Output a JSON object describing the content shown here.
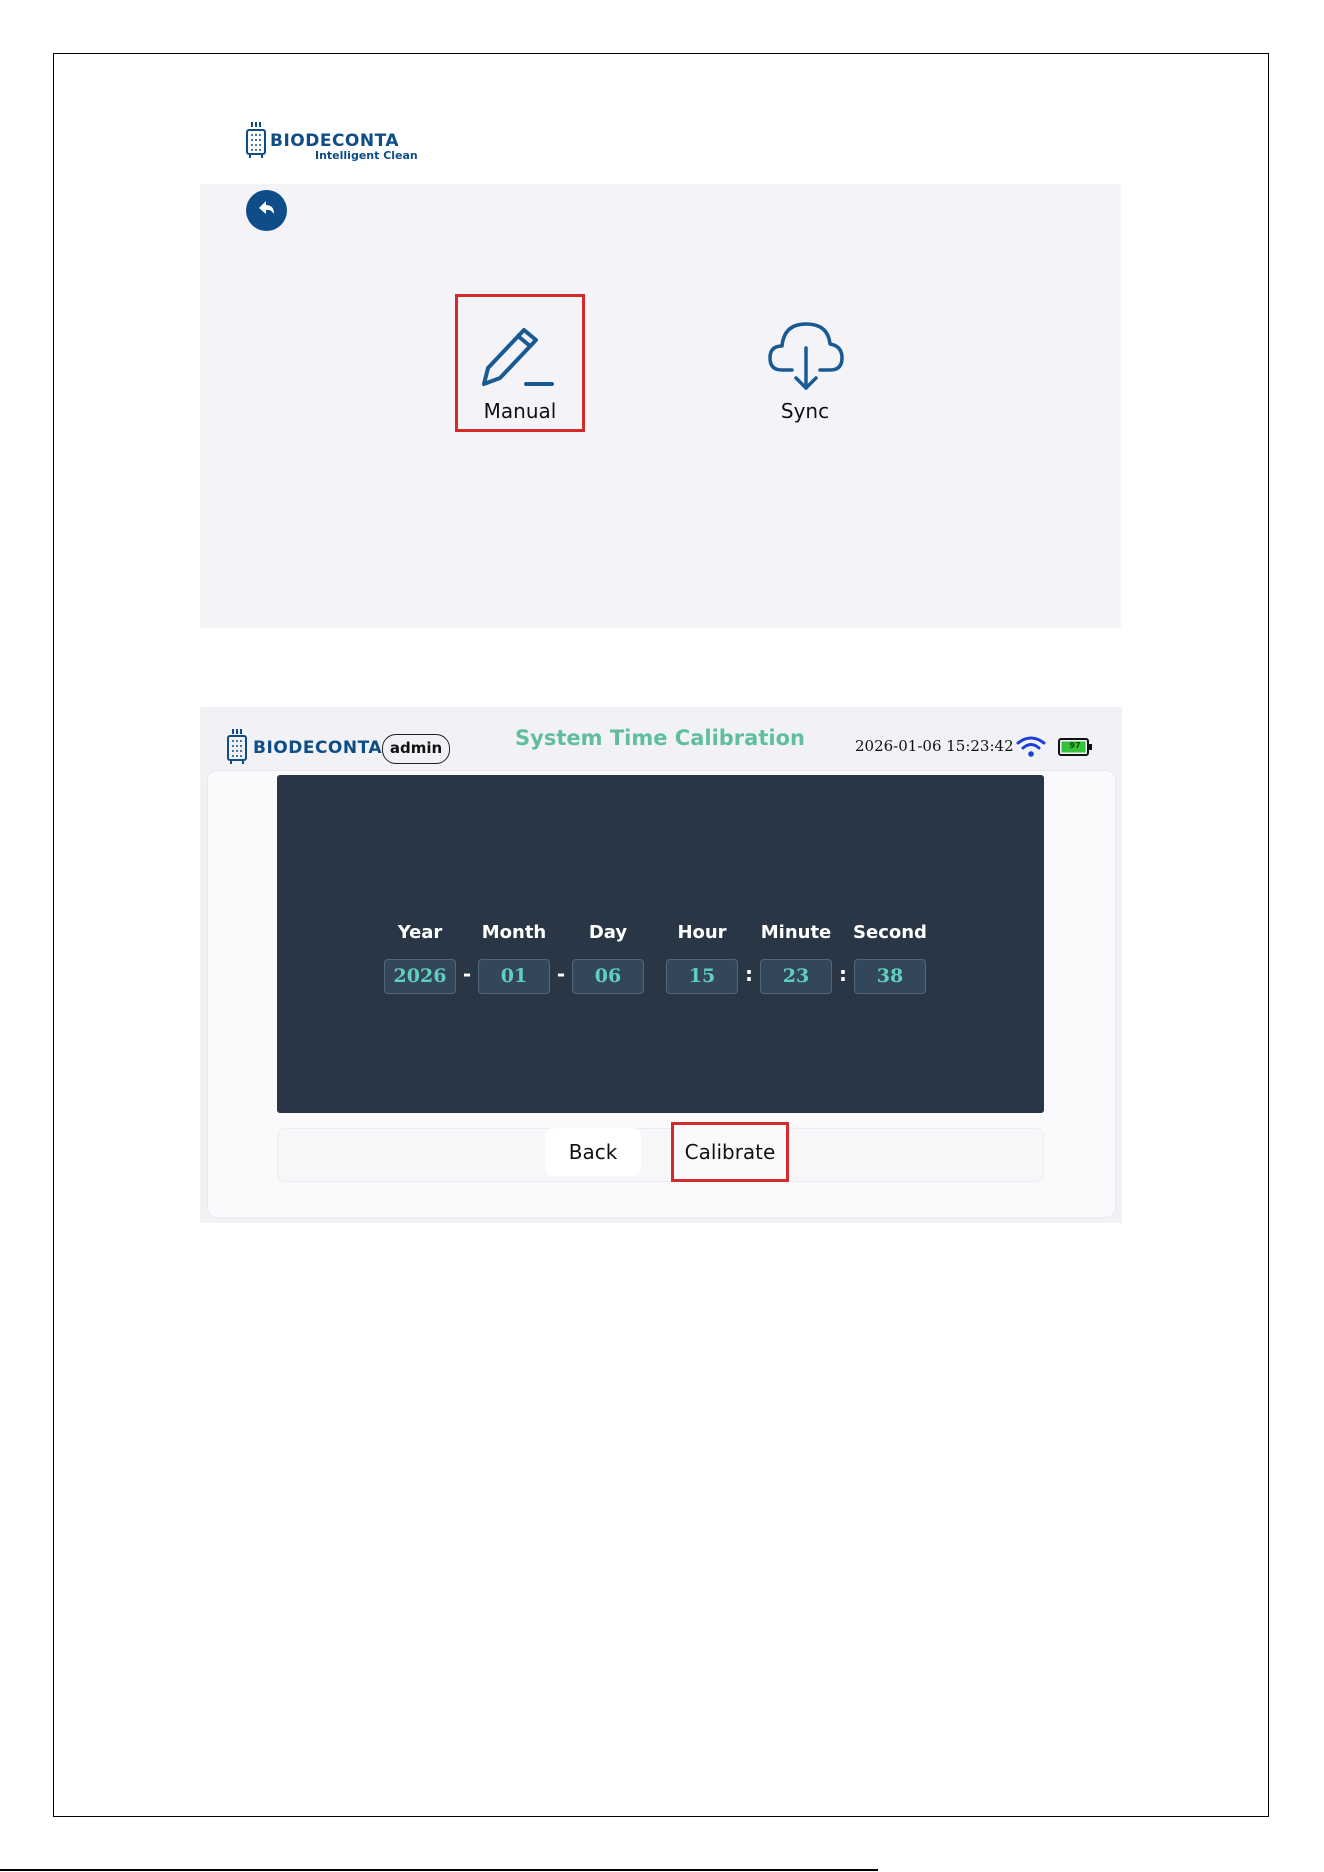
{
  "screen1": {
    "logo": {
      "brand": "BIODECONTA",
      "tagline": "Intelligent Clean"
    },
    "back_icon": "back-arrow-icon",
    "tiles": [
      {
        "label": "Manual",
        "icon": "pencil-edit-icon",
        "highlighted": true
      },
      {
        "label": "Sync",
        "icon": "cloud-download-icon",
        "highlighted": false
      }
    ]
  },
  "screen2": {
    "header": {
      "brand": "BIODECONTA",
      "user": "admin",
      "title": "System Time Calibration",
      "datetime": "2026-01-06 15:23:42",
      "battery_level": "97"
    },
    "time_fields": {
      "labels": [
        "Year",
        "Month",
        "Day",
        "Hour",
        "Minute",
        "Second"
      ],
      "values": [
        "2026",
        "01",
        "06",
        "15",
        "23",
        "38"
      ],
      "separators": [
        "-",
        "-",
        ":",
        ":"
      ]
    },
    "buttons": {
      "back": "Back",
      "calibrate": "Calibrate"
    }
  },
  "colors": {
    "highlight": "#d32b2b",
    "brand_blue": "#0e4d87",
    "title_green": "#5fbf9d",
    "panel_dark": "#293645",
    "value_teal": "#5fd0bd"
  }
}
